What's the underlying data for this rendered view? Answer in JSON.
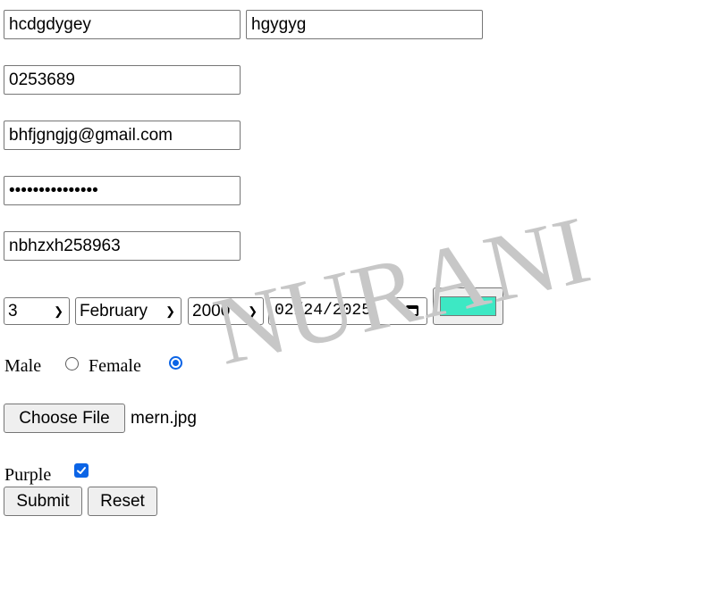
{
  "form": {
    "first_name": "hcdgdygey",
    "last_name": "hgygyg",
    "phone": "0253689",
    "email": "bhfjgngjg@gmail.com",
    "password_masked": "•••••••••••••••",
    "username": "nbhzxh258963",
    "day": "3",
    "month": "February",
    "year": "2000",
    "date": "02/24/2025",
    "color": "#3de8c4",
    "gender_male_label": "Male",
    "gender_female_label": "Female",
    "gender_selected": "Female",
    "file_button_label": "Choose File",
    "file_name": "mern.jpg",
    "checkbox_label": "Purple",
    "checkbox_checked": true,
    "submit_label": "Submit",
    "reset_label": "Reset"
  },
  "watermark": "NURANI"
}
